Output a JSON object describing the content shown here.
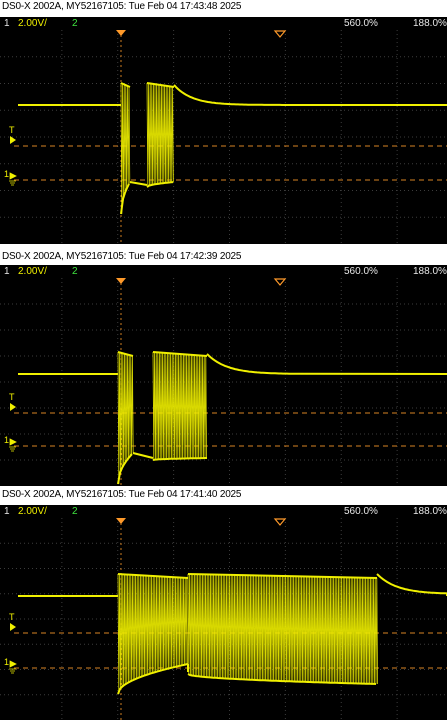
{
  "colors": {
    "trace": "#f0f000",
    "channel2": "#3ee23e",
    "marker": "#ff9a2a",
    "grid": "#3c3c3c",
    "background": "#000000"
  },
  "panels": [
    {
      "caption": "DS0-X 2002A, MY52167105: Tue Feb 04 17:43:48 2025",
      "channel_1": "1",
      "volts_per_div": "2.00V/",
      "channel_2": "2",
      "time_per_div": "560.0%",
      "trigger_delay": "188.0%"
    },
    {
      "caption": "DS0-X 2002A, MY52167105: Tue Feb 04 17:42:39 2025",
      "channel_1": "1",
      "volts_per_div": "2.00V/",
      "channel_2": "2",
      "time_per_div": "560.0%",
      "trigger_delay": "188.0%"
    },
    {
      "caption": "DS0-X 2002A, MY52167105: Tue Feb 04 17:41:40 2025",
      "channel_1": "1",
      "volts_per_div": "2.00V/",
      "channel_2": "2",
      "time_per_div": "560.0%",
      "trigger_delay": "188.0%"
    }
  ],
  "marker_labels": {
    "trigger_level": "T",
    "channel_1_ground": "1"
  },
  "icons": [
    "trigger-time-marker-icon",
    "delay-marker-icon",
    "trigger-level-arrow-icon",
    "ground-reference-icon"
  ]
}
